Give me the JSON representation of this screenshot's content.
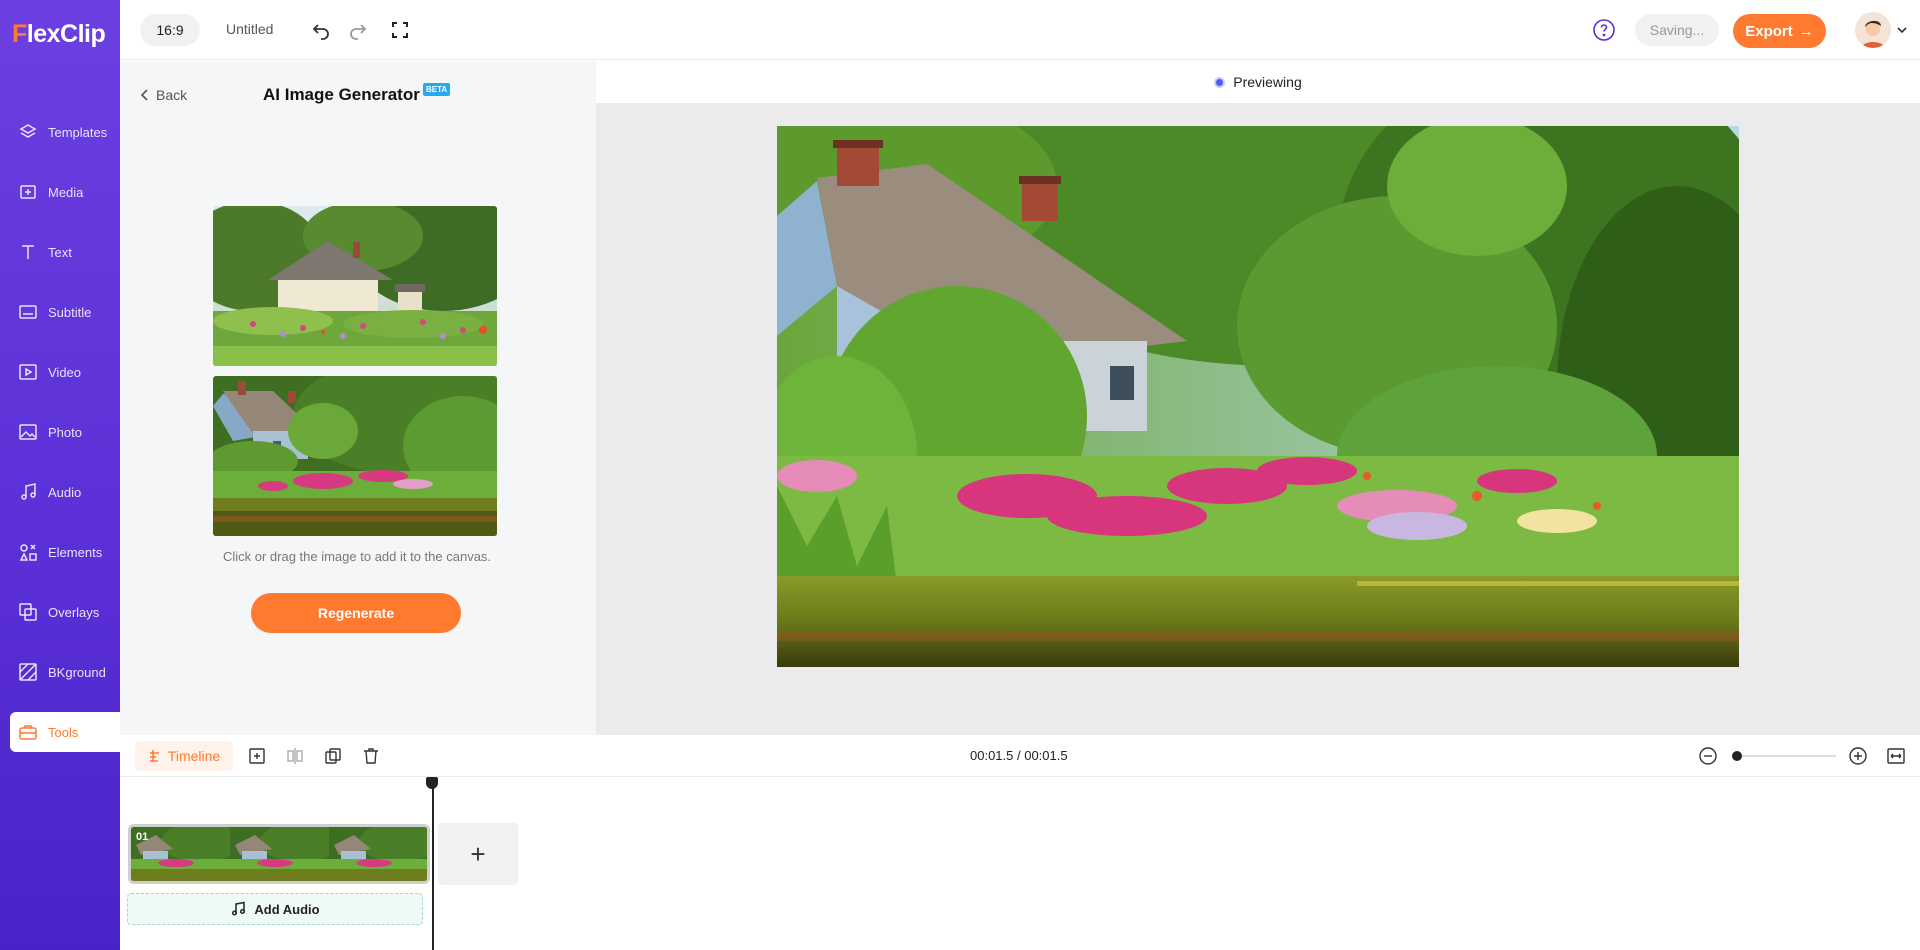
{
  "app": {
    "logo_first": "F",
    "logo_rest": "lexClip"
  },
  "sidebar": {
    "items": [
      {
        "label": "Templates",
        "icon": "layers-icon"
      },
      {
        "label": "Media",
        "icon": "folder-plus-icon"
      },
      {
        "label": "Text",
        "icon": "text-icon"
      },
      {
        "label": "Subtitle",
        "icon": "subtitle-icon"
      },
      {
        "label": "Video",
        "icon": "video-icon"
      },
      {
        "label": "Photo",
        "icon": "image-icon"
      },
      {
        "label": "Audio",
        "icon": "music-icon"
      },
      {
        "label": "Elements",
        "icon": "shapes-icon"
      },
      {
        "label": "Overlays",
        "icon": "overlay-icon"
      },
      {
        "label": "BKground",
        "icon": "background-icon"
      },
      {
        "label": "Tools",
        "icon": "toolbox-icon",
        "active": true
      }
    ]
  },
  "topbar": {
    "ratio": "16:9",
    "project_name": "Untitled",
    "saving": "Saving...",
    "export": "Export",
    "export_arrow": "→"
  },
  "panel": {
    "back": "Back",
    "title": "AI Image Generator",
    "badge": "BETA",
    "hint": "Click or drag the image to add it to the canvas.",
    "regenerate": "Regenerate"
  },
  "preview": {
    "status": "Previewing"
  },
  "timeline": {
    "label": "Timeline",
    "timecode": "00:01.5 / 00:01.5",
    "clip_number": "01",
    "add_scene": "+",
    "add_audio": "Add Audio",
    "zoom_level": 0
  },
  "colors": {
    "accent": "#ff7a2f",
    "sidebar": "#5a2fd6",
    "preview_dot": "#4d5bf0",
    "beta": "#28a8f0"
  }
}
